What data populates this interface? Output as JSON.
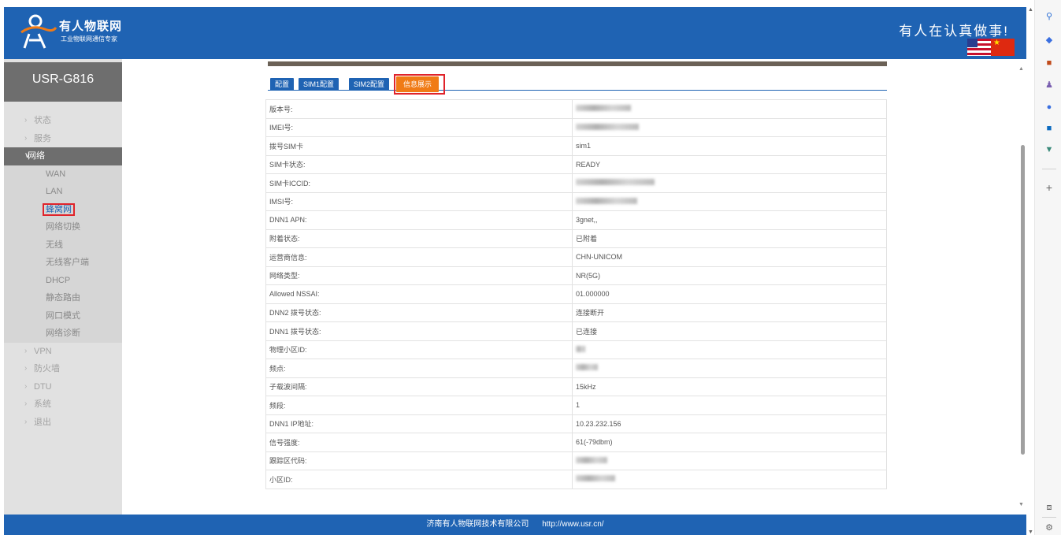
{
  "header": {
    "brand_name": "有人物联网",
    "brand_sub": "工业物联网通信专家",
    "slogan": "有人在认真做事!"
  },
  "sidebar": {
    "device_name": "USR-G816",
    "items": [
      {
        "label": "状态",
        "type": "group"
      },
      {
        "label": "服务",
        "type": "group"
      },
      {
        "label": "网络",
        "type": "open"
      },
      {
        "label": "WAN",
        "type": "sub"
      },
      {
        "label": "LAN",
        "type": "sub"
      },
      {
        "label": "蜂窝网",
        "type": "sub-active"
      },
      {
        "label": "网络切换",
        "type": "sub"
      },
      {
        "label": "无线",
        "type": "sub"
      },
      {
        "label": "无线客户端",
        "type": "sub"
      },
      {
        "label": "DHCP",
        "type": "sub"
      },
      {
        "label": "静态路由",
        "type": "sub"
      },
      {
        "label": "网口模式",
        "type": "sub"
      },
      {
        "label": "网络诊断",
        "type": "sub"
      },
      {
        "label": "VPN",
        "type": "group"
      },
      {
        "label": "防火墙",
        "type": "group"
      },
      {
        "label": "DTU",
        "type": "group"
      },
      {
        "label": "系统",
        "type": "group"
      },
      {
        "label": "退出",
        "type": "group"
      }
    ]
  },
  "tabs": [
    {
      "label": "配置"
    },
    {
      "label": "SIM1配置"
    },
    {
      "label": "SIM2配置"
    },
    {
      "label": "信息展示"
    }
  ],
  "info_rows": [
    {
      "key": "版本号:",
      "value": "",
      "blurred": true,
      "blur_w": 70
    },
    {
      "key": "IMEI号:",
      "value": "",
      "blurred": true,
      "blur_w": 80
    },
    {
      "key": "拨号SIM卡",
      "value": "sim1"
    },
    {
      "key": "SIM卡状态:",
      "value": "READY"
    },
    {
      "key": "SIM卡ICCID:",
      "value": "",
      "blurred": true,
      "blur_w": 100
    },
    {
      "key": "IMSI号:",
      "value": "",
      "blurred": true,
      "blur_w": 78
    },
    {
      "key": "DNN1 APN:",
      "value": "3gnet,,"
    },
    {
      "key": "附着状态:",
      "value": "已附着"
    },
    {
      "key": "运营商信息:",
      "value": "CHN-UNICOM"
    },
    {
      "key": "网络类型:",
      "value": "NR(5G)"
    },
    {
      "key": "Allowed NSSAI:",
      "value": "01.000000"
    },
    {
      "key": "DNN2 拨号状态:",
      "value": "连接断开"
    },
    {
      "key": "DNN1 拨号状态:",
      "value": "已连接"
    },
    {
      "key": "物理小区ID:",
      "value": "",
      "blurred": true,
      "blur_w": 12
    },
    {
      "key": "频点:",
      "value": "",
      "blurred": true,
      "blur_w": 28
    },
    {
      "key": "子载波间隔:",
      "value": "15kHz"
    },
    {
      "key": "频段:",
      "value": "1"
    },
    {
      "key": "DNN1 IP地址:",
      "value": "10.23.232.156"
    },
    {
      "key": "信号强度:",
      "value": "61(-79dbm)"
    },
    {
      "key": "跟踪区代码:",
      "value": "",
      "blurred": true,
      "blur_w": 40
    },
    {
      "key": "小区ID:",
      "value": "",
      "blurred": true,
      "blur_w": 50
    }
  ],
  "footer": {
    "company": "济南有人物联网技术有限公司",
    "url": "http://www.usr.cn/"
  },
  "colors": {
    "primary": "#1f63b3",
    "active_tab": "#f07b16",
    "highlight": "#e0232a"
  },
  "right_panel_icons": [
    "search-icon",
    "tag-icon",
    "toolbox-icon",
    "chess-icon",
    "copilot-icon",
    "outlook-icon",
    "send-icon",
    "plus-icon",
    "screenshot-icon",
    "settings-icon"
  ]
}
